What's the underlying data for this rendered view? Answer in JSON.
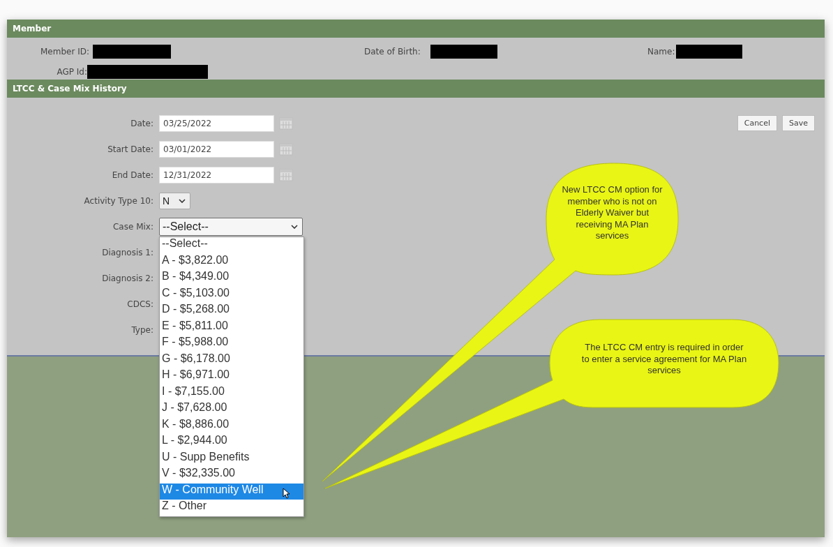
{
  "member": {
    "title": "Member",
    "fields": [
      {
        "label": "Member ID:"
      },
      {
        "label": "Date of Birth:"
      },
      {
        "label": "Name:"
      },
      {
        "label": "AGP Id:"
      }
    ]
  },
  "history": {
    "title": "LTCC & Case Mix History",
    "fields": [
      {
        "kind": "date",
        "label": "Date:",
        "value": "03/25/2022"
      },
      {
        "kind": "date",
        "label": "Start Date:",
        "value": "03/01/2022"
      },
      {
        "kind": "date",
        "label": "End Date:",
        "value": "12/31/2022"
      },
      {
        "kind": "small-select",
        "label": "Activity Type 10:",
        "value": "N"
      },
      {
        "kind": "select",
        "label": "Case Mix:",
        "value": "--Select--",
        "expanded": true
      },
      {
        "kind": "hidden",
        "label": "Diagnosis 1:"
      },
      {
        "kind": "hidden",
        "label": "Diagnosis 2:"
      },
      {
        "kind": "hidden",
        "label": "CDCS:"
      },
      {
        "kind": "hidden",
        "label": "Type:"
      }
    ],
    "buttons": [
      "Cancel",
      "Save"
    ],
    "options": [
      {
        "label": "--Select--",
        "selected": false
      },
      {
        "label": "A - $3,822.00",
        "selected": false
      },
      {
        "label": "B - $4,349.00",
        "selected": false
      },
      {
        "label": "C - $5,103.00",
        "selected": false
      },
      {
        "label": "D - $5,268.00",
        "selected": false
      },
      {
        "label": "E - $5,811.00",
        "selected": false
      },
      {
        "label": "F - $5,988.00",
        "selected": false
      },
      {
        "label": "G - $6,178.00",
        "selected": false
      },
      {
        "label": "H - $6,971.00",
        "selected": false
      },
      {
        "label": "I - $7,155.00",
        "selected": false
      },
      {
        "label": "J - $7,628.00",
        "selected": false
      },
      {
        "label": "K - $8,886.00",
        "selected": false
      },
      {
        "label": "L - $2,944.00",
        "selected": false
      },
      {
        "label": "U - Supp Benefits",
        "selected": false
      },
      {
        "label": "V - $32,335.00",
        "selected": false
      },
      {
        "label": "W - Community Well",
        "selected": true
      },
      {
        "label": "Z - Other",
        "selected": false
      }
    ]
  },
  "callouts": [
    {
      "text": "New LTCC CM option for member who is not on Elderly Waiver but receiving MA Plan services"
    },
    {
      "text": "The LTCC CM entry is required in order to enter a service agreement for MA Plan services"
    }
  ]
}
